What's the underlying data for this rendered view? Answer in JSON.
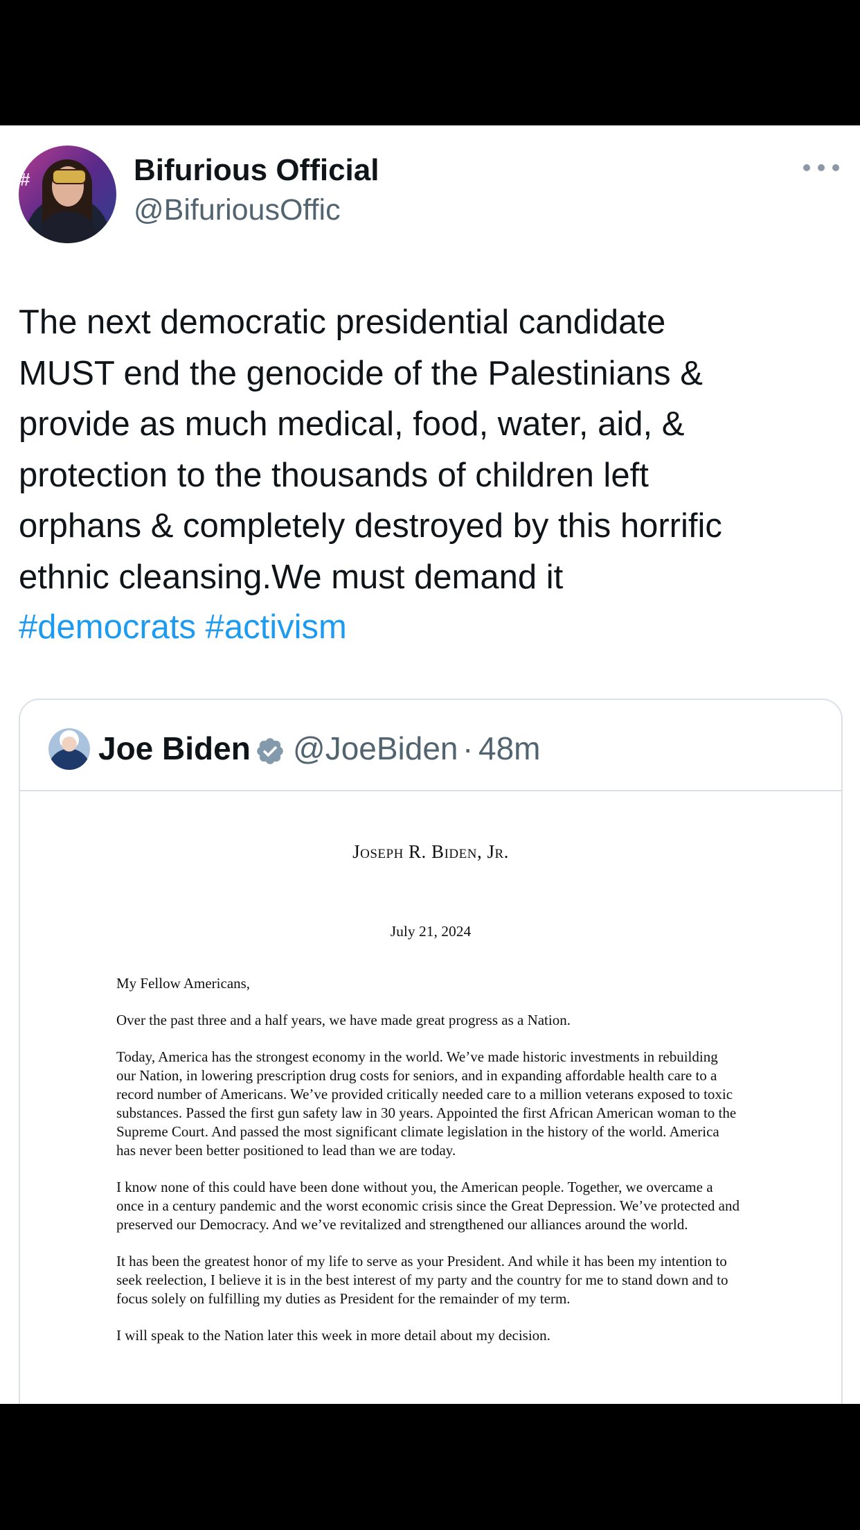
{
  "tweet": {
    "author_name": "Bifurious Official",
    "author_handle": "@BifuriousOffic",
    "text_lines": [
      "The next democratic presidential candidate",
      "MUST end the genocide of the Palestinians &",
      "provide as much medical, food, water, aid, &",
      "protection to the thousands of children left",
      "orphans & completely destroyed by this horrific",
      "ethnic cleansing.We must demand it"
    ],
    "hashtags": [
      "#democrats",
      "#activism"
    ],
    "icons": {
      "avatar": "profile-photo",
      "more": "more-options-icon"
    }
  },
  "quote": {
    "author_name": "Joe Biden",
    "author_handle": "@JoeBiden",
    "separator": "·",
    "time": "48m",
    "verified_color": "#829aab",
    "letter": {
      "letterhead": "Joseph R. Biden, Jr.",
      "date": "July 21, 2024",
      "salutation": "My Fellow Americans,",
      "paragraphs": [
        "Over the past three and a half years, we have made great progress as a Nation.",
        "Today, America has the strongest economy in the world. We’ve made historic investments in rebuilding our Nation, in lowering prescription drug costs for seniors, and in expanding affordable health care to a record number of Americans. We’ve provided critically needed care to a million veterans exposed to toxic substances. Passed the first gun safety law in 30 years. Appointed the first African American woman to the Supreme Court. And passed the most significant climate legislation in the history of the world. America has never been better positioned to lead than we are today.",
        "I know none of this could have been done without you, the American people. Together, we overcame a once in a century pandemic and the worst economic crisis since the Great Depression. We’ve protected and preserved our Democracy. And we’ve revitalized and strengthened our alliances around the world.",
        "It has been the greatest honor of my life to serve as your President. And while it has been my intention to seek reelection, I believe it is in the best interest of my party and the country for me to stand down and to focus solely on fulfilling my duties as President for the remainder of my term.",
        "I will speak to the Nation later this week in more detail about my decision."
      ]
    }
  },
  "colors": {
    "hashtag": "#1d9bf0",
    "secondary_text": "#536471",
    "border": "#dbe1e6"
  }
}
